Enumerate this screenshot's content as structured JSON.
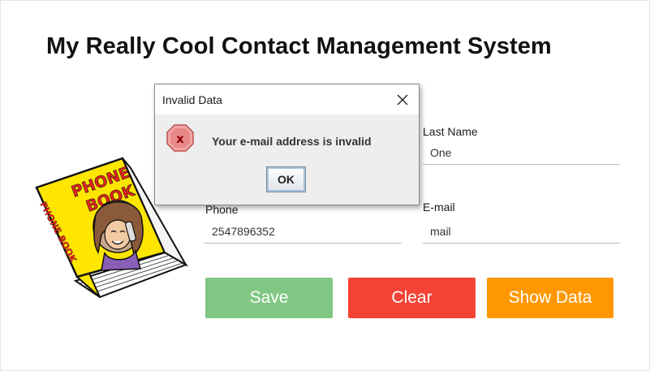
{
  "app": {
    "title": "My Really Cool Contact Management System"
  },
  "form": {
    "last_name_label": "Last Name",
    "last_name_value": "One",
    "phone_label": "Phone",
    "phone_value": "2547896352",
    "email_label": "E-mail",
    "email_value": "mail"
  },
  "buttons": {
    "save": "Save",
    "clear": "Clear",
    "show_data": "Show Data"
  },
  "dialog": {
    "title": "Invalid Data",
    "message": "Your e-mail address is invalid",
    "ok": "OK",
    "icon": "error-x-icon"
  },
  "illustration": {
    "cover_text_1": "PHONE",
    "cover_text_2": "BOOK",
    "spine_text": "PHONE BOOK"
  },
  "colors": {
    "save": "#81c784",
    "clear": "#f44336",
    "show_data": "#ff9800",
    "book_yellow": "#ffe600",
    "book_red": "#e8231f"
  }
}
